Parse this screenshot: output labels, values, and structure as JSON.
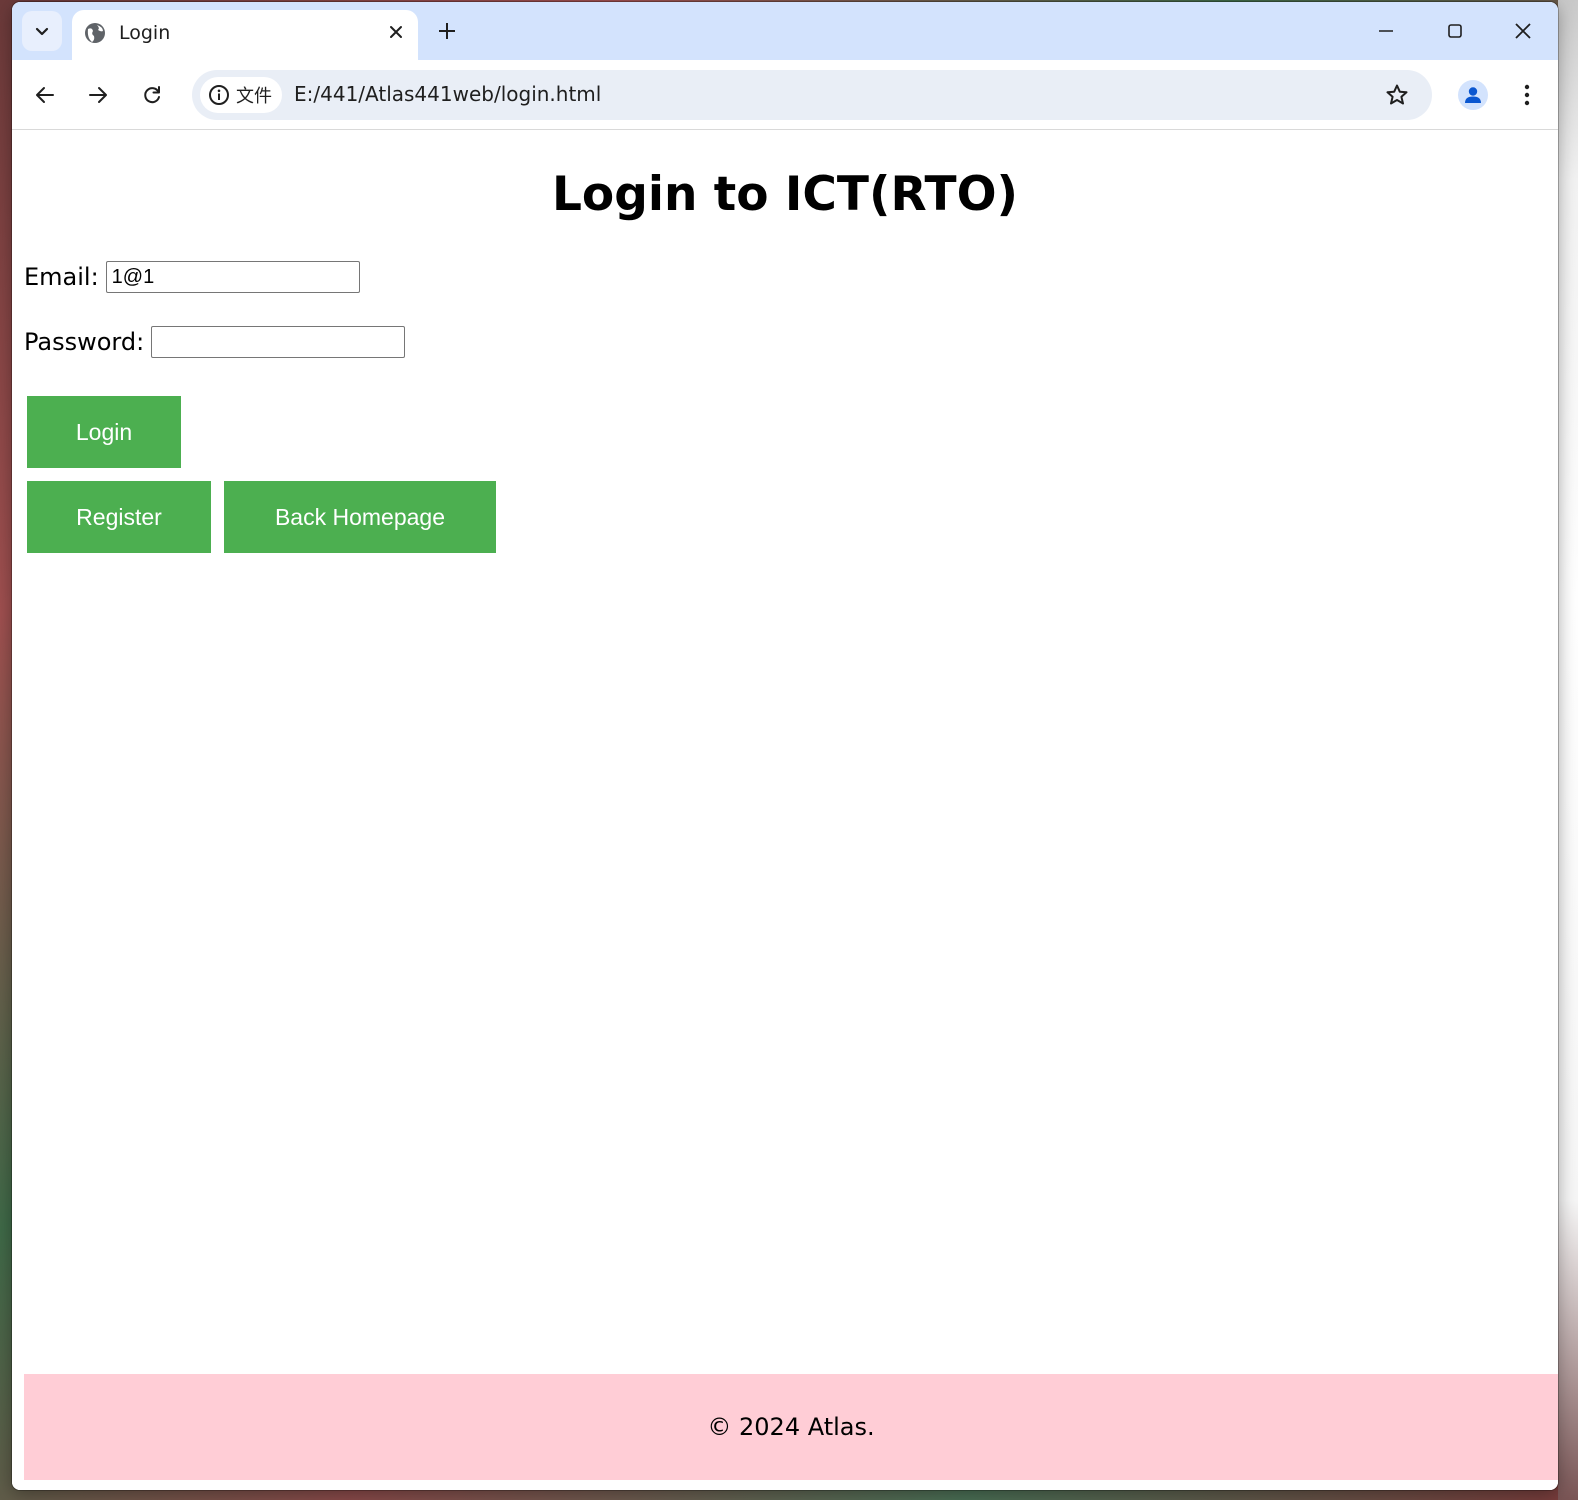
{
  "browser": {
    "tab": {
      "title": "Login"
    },
    "address_bar": {
      "site_info_label": "文件",
      "url": "E:/441/Atlas441web/login.html"
    }
  },
  "page": {
    "title": "Login to ICT(RTO)",
    "form": {
      "email_label": "Email:",
      "email_value": "1@1",
      "password_label": "Password:",
      "password_value": ""
    },
    "buttons": {
      "login": "Login",
      "register": "Register",
      "back_homepage": "Back Homepage"
    },
    "footer": {
      "text": "© 2024 Atlas."
    }
  },
  "colors": {
    "button_bg": "#4caf50",
    "footer_bg": "#ffcdd6",
    "tabstrip_bg": "#d3e3fd"
  }
}
